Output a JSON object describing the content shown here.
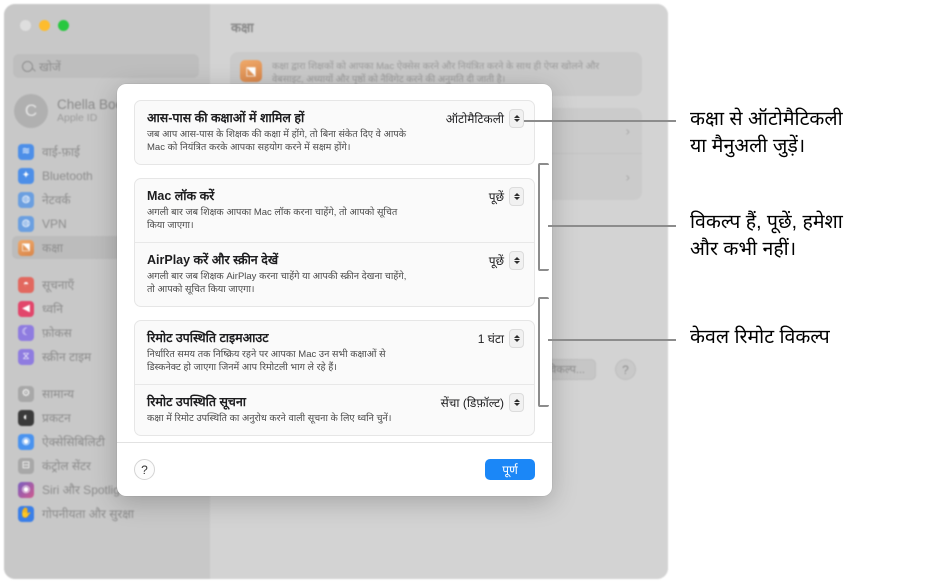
{
  "window": {
    "traffic_lights": [
      "close",
      "minimize",
      "zoom"
    ],
    "search": {
      "placeholder": "खोजें",
      "icon": "search-icon"
    },
    "account": {
      "initial": "C",
      "name": "Chella Boe",
      "subtitle": "Apple ID"
    },
    "sidebar_items": [
      {
        "label": "वाई-फ़ाई",
        "icon": "wifi-icon",
        "color": "#4d8fe8",
        "glyph": "≋",
        "selected": false
      },
      {
        "label": "Bluetooth",
        "icon": "bluetooth-icon",
        "color": "#4d8fe8",
        "glyph": "✦",
        "selected": false
      },
      {
        "label": "नेटवर्क",
        "icon": "network-icon",
        "color": "#4d8fe8",
        "glyph": "◍",
        "selected": false
      },
      {
        "label": "VPN",
        "icon": "vpn-icon",
        "color": "#4d8fe8",
        "glyph": "◍",
        "selected": false
      },
      {
        "label": "कक्षा",
        "icon": "classroom-icon",
        "color": "#d9864a",
        "glyph": "⬔",
        "selected": true
      },
      {
        "label": "सूचनाएँ",
        "icon": "notifications-icon",
        "color": "#e2685f",
        "glyph": "🔔",
        "selected": false
      },
      {
        "label": "ध्वनि",
        "icon": "sound-icon",
        "color": "#e2466b",
        "glyph": "◀",
        "selected": false
      },
      {
        "label": "फ़ोकस",
        "icon": "focus-icon",
        "color": "#8f7ce0",
        "glyph": "☾",
        "selected": false
      },
      {
        "label": "स्क्रीन टाइम",
        "icon": "screen-time-icon",
        "color": "#8f7ce0",
        "glyph": "⧖",
        "selected": false
      },
      {
        "label": "सामान्य",
        "icon": "general-icon",
        "color": "#9a9a9a",
        "glyph": "⚙",
        "selected": false
      },
      {
        "label": "प्रकटन",
        "icon": "appearance-icon",
        "color": "#3a3a3a",
        "glyph": "◐",
        "selected": false
      },
      {
        "label": "ऐक्सेसिबिलिटी",
        "icon": "accessibility-icon",
        "color": "#2f86f0",
        "glyph": "♿",
        "selected": false
      },
      {
        "label": "कंट्रोल सेंटर",
        "icon": "control-center-icon",
        "color": "#9a9a9a",
        "glyph": "⊟",
        "selected": false
      },
      {
        "label": "Siri और Spotlight",
        "icon": "siri-icon",
        "color": "#7a5fc0",
        "glyph": "◉",
        "selected": false
      },
      {
        "label": "गोपनीयता और सुरक्षा",
        "icon": "privacy-icon",
        "color": "#3a7fe8",
        "glyph": "✋",
        "selected": false
      }
    ],
    "detail": {
      "title": "कक्षा",
      "description": "कक्षा द्वारा शिक्षकों को आपका Mac ऐक्सेस करने और नियंत्रित करने के साथ ही ऐप्स खोलने और वेबसाइट, अध्यायों और पृष्ठों को नैविगेट करने की अनुमति दी जाती है।",
      "description_icon": "classroom-icon",
      "options_button": "विकल्प...",
      "help_button": "?"
    }
  },
  "sheet": {
    "groups": [
      {
        "rows": [
          {
            "title": "आस-पास की कक्षाओं में शामिल हों",
            "subtitle": "जब आप आस-पास के शिक्षक की कक्षा में होंगे, तो बिना संकेत दिए वे आपके Mac को नियंत्रित करके आपका सहयोग करने में सक्षम होंगे।",
            "value": "ऑटोमैटिकली"
          }
        ]
      },
      {
        "rows": [
          {
            "title": "Mac लॉक करें",
            "subtitle": "अगली बार जब शिक्षक आपका Mac लॉक करना चाहेंगे, तो आपको सूचित किया जाएगा।",
            "value": "पूछें"
          },
          {
            "title": "AirPlay करें और स्क्रीन देखें",
            "subtitle": "अगली बार जब शिक्षक AirPlay करना चाहेंगे या आपकी स्क्रीन देखना चाहेंगे, तो आपको सूचित किया जाएगा।",
            "value": "पूछें"
          }
        ]
      },
      {
        "rows": [
          {
            "title": "रिमोट उपस्थिति टाइमआउट",
            "subtitle": "निर्धारित समय तक निष्क्रिय रहने पर आपका Mac उन सभी कक्षाओं से डिस्कनेक्ट हो जाएगा जिनमें आप रिमोटली भाग ले रहे हैं।",
            "value": "1 घंटा"
          },
          {
            "title": "रिमोट उपस्थिति सूचना",
            "subtitle": "कक्षा में रिमोट उपस्थिति का अनुरोध करने वाली सूचना के लिए ध्वनि चुनें।",
            "value": "सेंचा (डिफ़ॉल्ट)"
          }
        ]
      }
    ],
    "footer": {
      "help_label": "?",
      "done_label": "पूर्ण",
      "done_color": "#1b87f7"
    }
  },
  "callouts": [
    {
      "text": "कक्षा से ऑटोमैटिकली\nया मैनुअली जुड़ें।",
      "marker": "line"
    },
    {
      "text": "विकल्प हैं, पूछें, हमेशा\nऔर कभी नहीं।",
      "marker": "bracket"
    },
    {
      "text": "केवल रिमोट विकल्प",
      "marker": "bracket"
    }
  ]
}
